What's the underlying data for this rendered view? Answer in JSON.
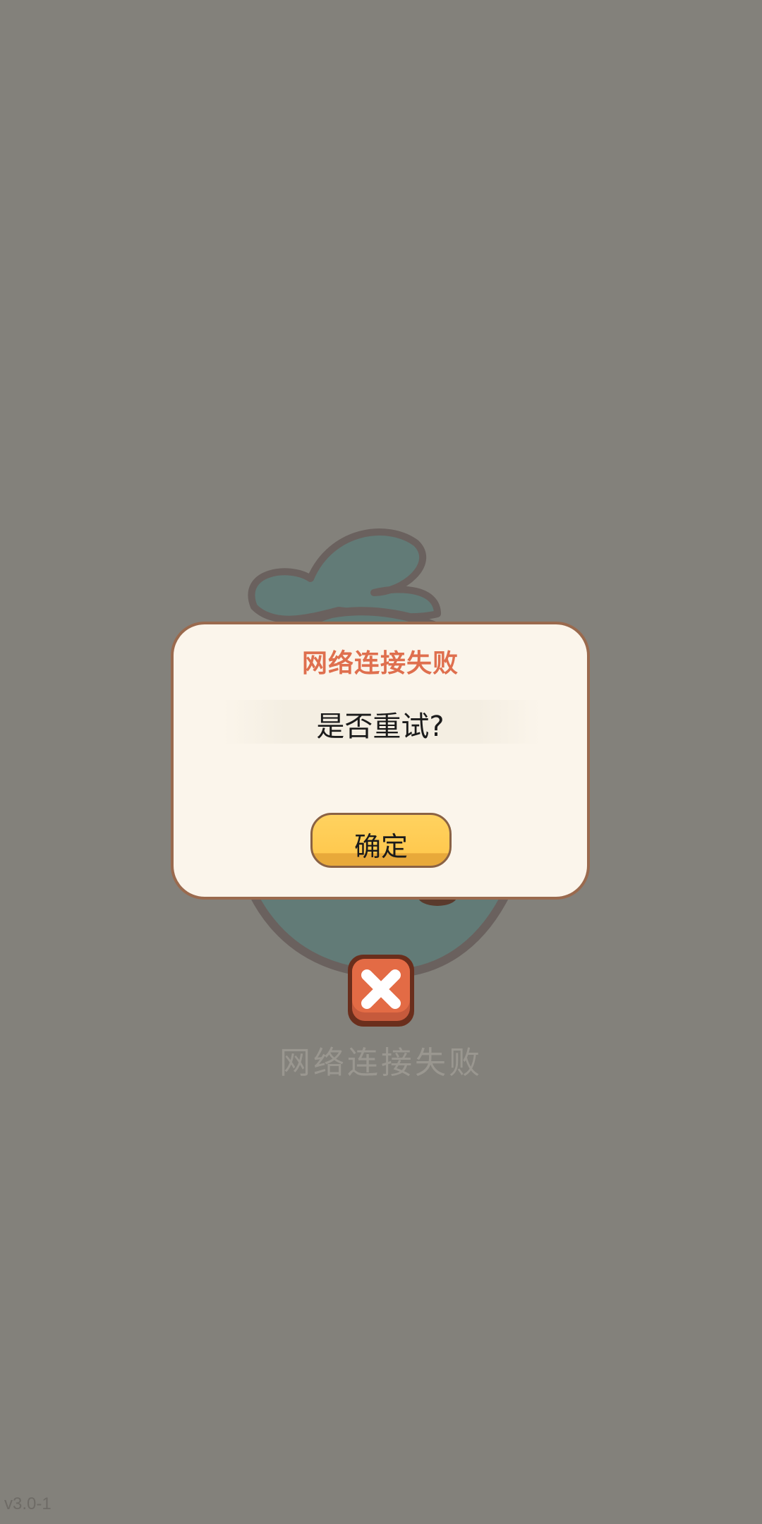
{
  "background": {
    "error_text": "网络连接失败",
    "version": "v3.0-1"
  },
  "dialog": {
    "title": "网络连接失败",
    "message": "是否重试?",
    "confirm_label": "确定"
  },
  "colors": {
    "overlay": "#83817b",
    "dialog_bg": "#fbf5eb",
    "dialog_border": "#9a6a4e",
    "title": "#df6f4e",
    "button_fill": "#ffcc52",
    "error_icon": "#e06a42"
  },
  "icons": {
    "mascot": "sad-mascot-icon",
    "error": "error-x-icon"
  }
}
